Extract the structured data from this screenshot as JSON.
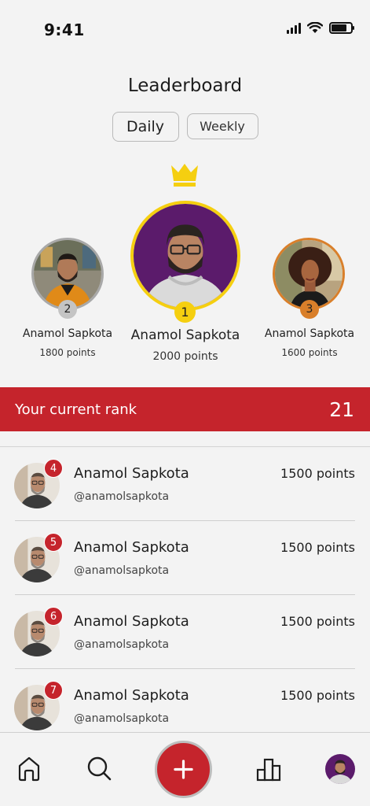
{
  "status_bar": {
    "time": "9:41",
    "icons": [
      "signal-icon",
      "wifi-icon",
      "battery-icon"
    ]
  },
  "header": {
    "title": "Leaderboard"
  },
  "tabs": [
    {
      "label": "Daily",
      "selected": true
    },
    {
      "label": "Weekly",
      "selected": false
    }
  ],
  "podium": {
    "first": {
      "rank": "1",
      "name": "Anamol Sapkota",
      "points": "2000 points",
      "ring_color": "#f5cf10"
    },
    "second": {
      "rank": "2",
      "name": "Anamol Sapkota",
      "points": "1800 points",
      "ring_color": "#a8a8a8"
    },
    "third": {
      "rank": "3",
      "name": "Anamol Sapkota",
      "points": "1600 points",
      "ring_color": "#d97f2a"
    }
  },
  "current_rank": {
    "label": "Your current rank",
    "value": "21",
    "bar_color": "#c5242c"
  },
  "list": [
    {
      "rank": "4",
      "name": "Anamol Sapkota",
      "handle": "@anamolsapkota",
      "points": "1500 points"
    },
    {
      "rank": "5",
      "name": "Anamol Sapkota",
      "handle": "@anamolsapkota",
      "points": "1500 points"
    },
    {
      "rank": "6",
      "name": "Anamol Sapkota",
      "handle": "@anamolsapkota",
      "points": "1500 points"
    },
    {
      "rank": "7",
      "name": "Anamol Sapkota",
      "handle": "@anamolsapkota",
      "points": "1500 points"
    }
  ],
  "tab_bar": {
    "items": [
      "home-icon",
      "search-icon",
      "add-icon",
      "leaderboard-icon",
      "profile-avatar"
    ],
    "accent": "#c5242c"
  }
}
